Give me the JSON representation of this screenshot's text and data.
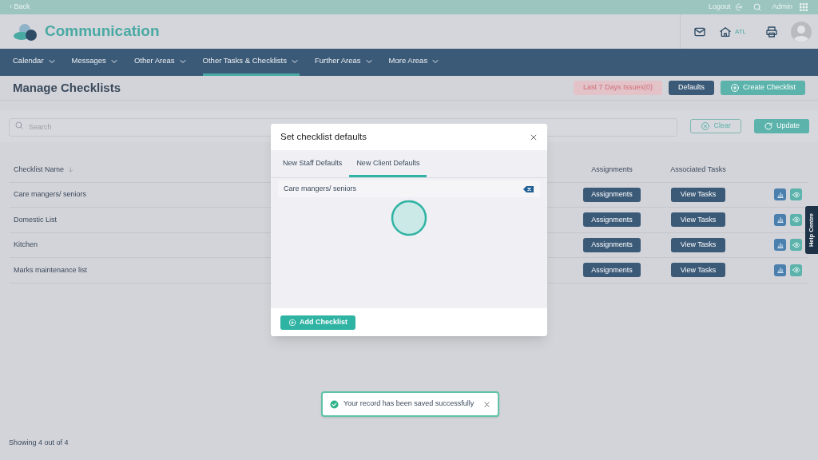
{
  "top_bar": {
    "back": "‹ Back",
    "logout": "Logout",
    "user": "Admin"
  },
  "header": {
    "app_title": "Communication",
    "location": "ATL"
  },
  "nav": [
    {
      "label": "Calendar",
      "selected": false
    },
    {
      "label": "Messages",
      "selected": false
    },
    {
      "label": "Other Areas",
      "selected": false
    },
    {
      "label": "Other Tasks & Checklists",
      "selected": true
    },
    {
      "label": "Further Areas",
      "selected": false
    },
    {
      "label": "More Areas",
      "selected": false
    }
  ],
  "page": {
    "title": "Manage Checklists",
    "buttons": [
      {
        "kind": "alert",
        "label": "Last 7 Days Issues(0)"
      },
      {
        "kind": "dark",
        "label": "Defaults"
      },
      {
        "kind": "primary",
        "label": "Create Checklist"
      }
    ]
  },
  "filter": {
    "placeholder": "Search",
    "clear": "Clear",
    "update": "Update"
  },
  "table": {
    "columns": [
      "Checklist Name",
      "Assignments",
      "Associated Tasks"
    ],
    "rows": [
      {
        "name": "Care mangers/ seniors",
        "assignments": "Assignments",
        "tasks": "View Tasks"
      },
      {
        "name": "Domestic List",
        "assignments": "Assignments",
        "tasks": "View Tasks"
      },
      {
        "name": "Kitchen",
        "assignments": "Assignments",
        "tasks": "View Tasks"
      },
      {
        "name": "Marks maintenance list",
        "assignments": "Assignments",
        "tasks": "View Tasks"
      }
    ]
  },
  "modal": {
    "title": "Set checklist defaults",
    "tabs": [
      {
        "label": "New Staff Defaults",
        "selected": false
      },
      {
        "label": "New Client Defaults",
        "selected": true
      }
    ],
    "items": [
      "Care mangers/ seniors"
    ],
    "button": "Add Checklist"
  },
  "toast": {
    "message": "Your record has been saved successfully"
  },
  "help_tab": "Help Centre",
  "footer": "Showing 4 out of 4"
}
